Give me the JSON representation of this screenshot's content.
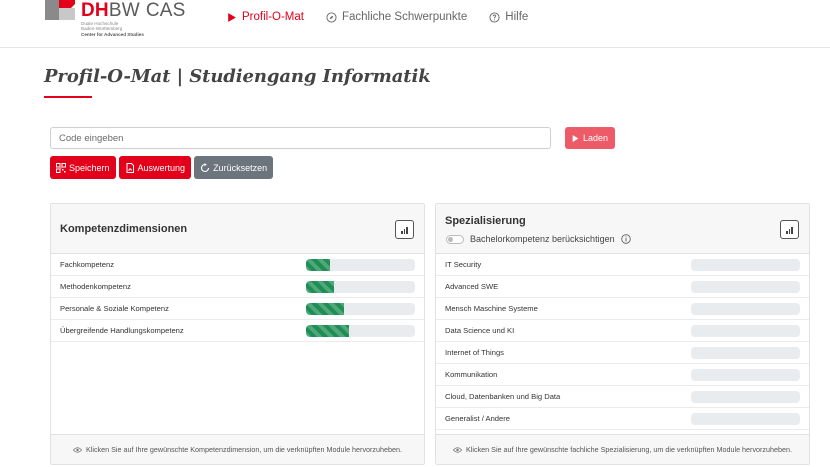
{
  "header": {
    "logo": {
      "brand_dh": "DH",
      "brand_bw": "BW",
      "brand_cas": "CAS",
      "sub_line1": "Duale Hochschule",
      "sub_line2": "Baden-Württemberg",
      "sub_line3": "Center for Advanced Studies"
    },
    "nav": [
      {
        "label": "Profil-O-Mat",
        "icon": "play-icon",
        "active": true
      },
      {
        "label": "Fachliche Schwerpunkte",
        "icon": "compass-icon",
        "active": false
      },
      {
        "label": "Hilfe",
        "icon": "question-circle-icon",
        "active": false
      }
    ]
  },
  "page": {
    "title": "Profil-O-Mat | Studiengang Informatik"
  },
  "code": {
    "placeholder": "Code eingeben",
    "value": "",
    "load_label": "Laden"
  },
  "actions": {
    "save_label": "Speichern",
    "evaluation_label": "Auswertung",
    "reset_label": "Zurücksetzen"
  },
  "kompetenz": {
    "title": "Kompetenzdimensionen",
    "items": [
      {
        "label": "Fachkompetenz",
        "progress": 22
      },
      {
        "label": "Methodenkompetenz",
        "progress": 26
      },
      {
        "label": "Personale & Soziale Kompetenz",
        "progress": 35
      },
      {
        "label": "Übergreifende Handlungskompetenz",
        "progress": 39
      }
    ],
    "footer": "Klicken Sie auf Ihre gewünschte Kompetenzdimension, um die verknüpften Module hervorzuheben."
  },
  "spezialisierung": {
    "title": "Spezialisierung",
    "toggle_label": "Bachelorkompetenz berücksichtigen",
    "toggle_on": false,
    "items": [
      {
        "label": "IT Security",
        "progress": 0
      },
      {
        "label": "Advanced SWE",
        "progress": 0
      },
      {
        "label": "Mensch Maschine Systeme",
        "progress": 0
      },
      {
        "label": "Data Science und KI",
        "progress": 0
      },
      {
        "label": "Internet of Things",
        "progress": 0
      },
      {
        "label": "Kommunikation",
        "progress": 0
      },
      {
        "label": "Cloud, Datenbanken und Big Data",
        "progress": 0
      },
      {
        "label": "Generalist / Andere",
        "progress": 0
      }
    ],
    "footer": "Klicken Sie auf Ihre gewünschte fachliche Spezialisierung, um die verknüpften Module hervorzuheben."
  },
  "colors": {
    "brand_red": "#e2001a",
    "load_button": "#ed5a68",
    "reset_button": "#6c757d",
    "progress_green": "#1e8e55",
    "progress_track": "#e9ecef"
  }
}
